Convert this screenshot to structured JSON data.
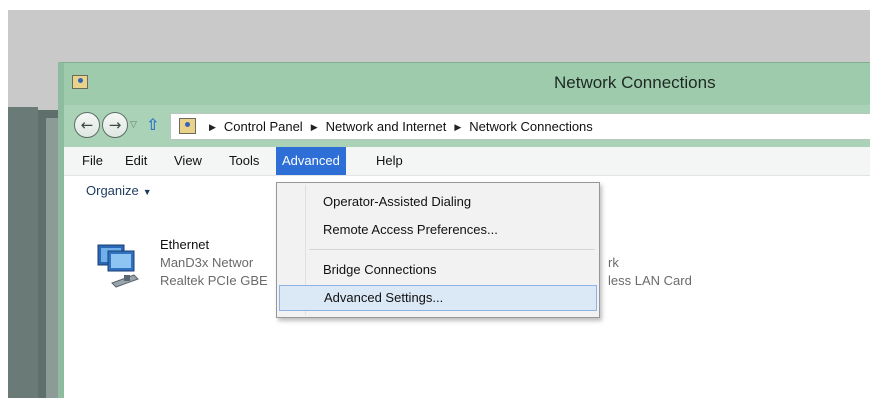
{
  "window": {
    "title": "Network Connections"
  },
  "address": {
    "crumbs": [
      "Control Panel",
      "Network and Internet",
      "Network Connections"
    ]
  },
  "menubar": {
    "items": [
      {
        "label": "File"
      },
      {
        "label": "Edit"
      },
      {
        "label": "View"
      },
      {
        "label": "Tools"
      },
      {
        "label": "Advanced"
      },
      {
        "label": "Help"
      }
    ]
  },
  "toolbar": {
    "organize_label": "Organize"
  },
  "connections": [
    {
      "name": "Ethernet",
      "network": "ManD3x Networ",
      "adapter": "Realtek PCIe GBE"
    },
    {
      "network": "rk",
      "adapter": "less LAN Card"
    }
  ],
  "advanced_menu": {
    "items": [
      {
        "label": "Operator-Assisted Dialing"
      },
      {
        "label": "Remote Access Preferences..."
      },
      {
        "label": "Bridge Connections"
      },
      {
        "label": "Advanced Settings..."
      }
    ]
  },
  "colors": {
    "titlebar": "#9fcbad",
    "menu_active": "#2d6fd6",
    "hover_item": "#dbe8f6"
  }
}
